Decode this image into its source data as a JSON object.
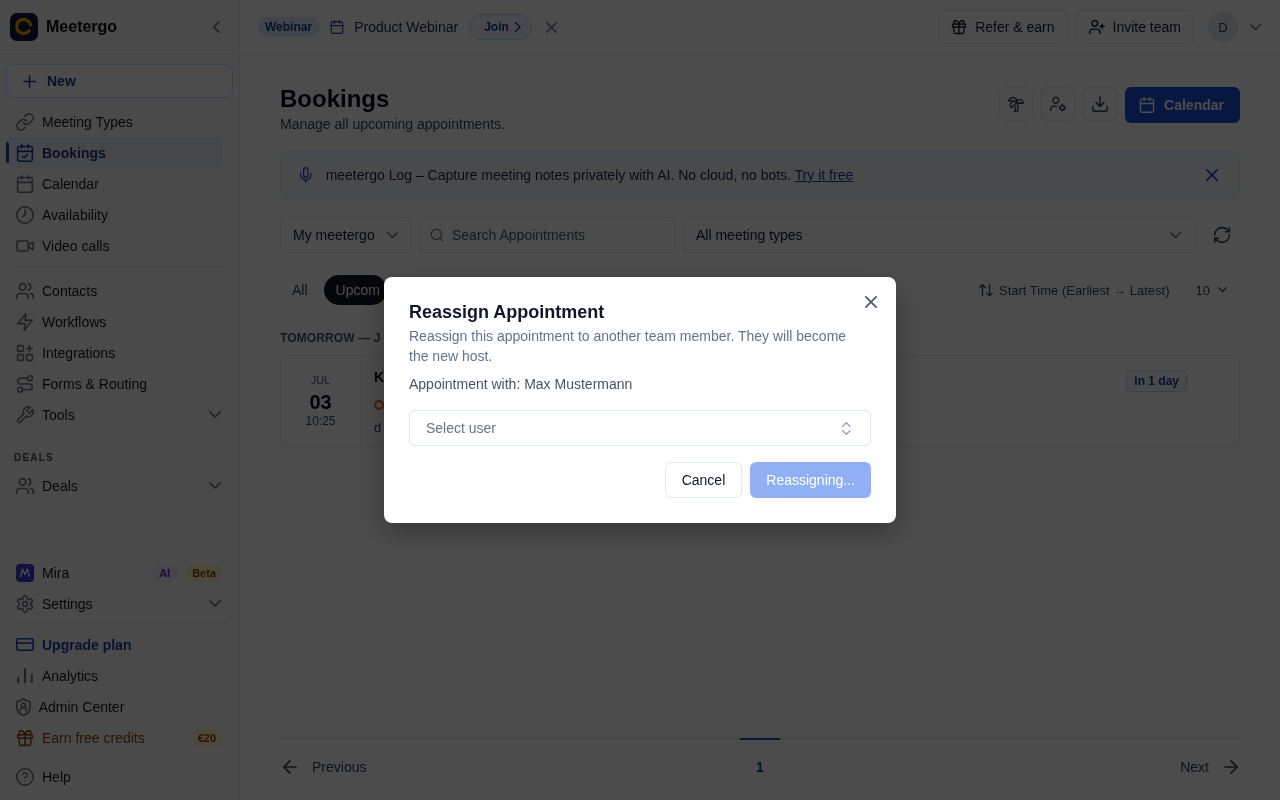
{
  "sidebar": {
    "brand": "Meetergo",
    "new_button": "New",
    "groups": [
      {
        "items": [
          {
            "kind": "link",
            "label": "Meeting Types",
            "selected": false
          },
          {
            "kind": "link",
            "label": "Bookings",
            "selected": true
          },
          {
            "kind": "link",
            "label": "Calendar",
            "selected": false
          },
          {
            "kind": "link",
            "label": "Availability",
            "selected": false
          },
          {
            "kind": "link",
            "label": "Video calls",
            "selected": false
          }
        ]
      },
      {
        "items": [
          {
            "kind": "link",
            "label": "Contacts",
            "selected": false
          },
          {
            "kind": "link",
            "label": "Workflows",
            "selected": false
          },
          {
            "kind": "link",
            "label": "Integrations",
            "selected": false
          },
          {
            "kind": "link",
            "label": "Forms & Routing",
            "selected": false
          },
          {
            "kind": "menu",
            "label": "Tools",
            "selected": false,
            "expanded": false
          }
        ]
      },
      {
        "heading": "DEALS",
        "items": [
          {
            "kind": "menu",
            "label": "Deals",
            "selected": false,
            "expanded": false
          }
        ]
      }
    ],
    "footer_groups": [
      {
        "items": [
          {
            "kind": "link",
            "label": "Mira",
            "selected": false,
            "badges": [
              {
                "text": "AI",
                "kind": "ai"
              },
              {
                "text": "Beta",
                "kind": "beta"
              }
            ]
          },
          {
            "kind": "menu",
            "label": "Settings",
            "selected": false,
            "expanded": false
          }
        ]
      },
      {
        "items": [
          {
            "kind": "upgrade",
            "label": "Upgrade plan",
            "selected": false
          },
          {
            "kind": "link",
            "label": "Analytics",
            "selected": false
          },
          {
            "kind": "link",
            "label": "Admin Center",
            "selected": false
          },
          {
            "kind": "reward",
            "label": "Earn free credits",
            "selected": false,
            "badges": [
              {
                "text": "€20",
                "kind": "reward"
              }
            ]
          }
        ]
      },
      {
        "items": [
          {
            "kind": "link",
            "label": "Help",
            "selected": false
          }
        ]
      }
    ]
  },
  "topbar": {
    "event": {
      "tag": "Webinar",
      "title": "Product Webinar",
      "join": "Join"
    },
    "actions": [
      {
        "label": "Refer & earn"
      },
      {
        "label": "Invite team"
      }
    ],
    "avatar": "D"
  },
  "page": {
    "title": "Bookings",
    "subtitle": "Manage all upcoming appointments.",
    "primary_action": "Calendar"
  },
  "banner": {
    "message": "meetergo Log – Capture meeting notes privately with AI. No cloud, no bots.",
    "link": "Try it free"
  },
  "filters": {
    "owner": "My meetergo",
    "search": {
      "placeholder": "Search Appointments"
    },
    "meeting_type": "All meeting types"
  },
  "tabs": [
    {
      "label": "All",
      "selected": false
    },
    {
      "label": "Upcom",
      "selected": true
    }
  ],
  "sort": {
    "label": "Start Time (Earliest → Latest)",
    "page_size": "10"
  },
  "booking_groups": [
    {
      "heading": "TOMORROW — J",
      "bookings": [
        {
          "month": "JUL",
          "day": "03",
          "time": "10:25",
          "title": "K",
          "detail": "d",
          "relative": "in 1 day"
        }
      ]
    }
  ],
  "pagination": {
    "previous": "Previous",
    "pages": [
      {
        "label": "1",
        "selected": true
      }
    ],
    "next": "Next"
  },
  "dialog": {
    "title": "Reassign Appointment",
    "description": "Reassign this appointment to another team member. They will become the new host.",
    "context": "Appointment with: Max Mustermann",
    "select": {
      "placeholder": "Select user"
    },
    "buttons": [
      {
        "label": "Cancel",
        "kind": "secondary",
        "disabled": false
      },
      {
        "label": "Reassigning...",
        "kind": "primary",
        "disabled": true
      }
    ]
  }
}
